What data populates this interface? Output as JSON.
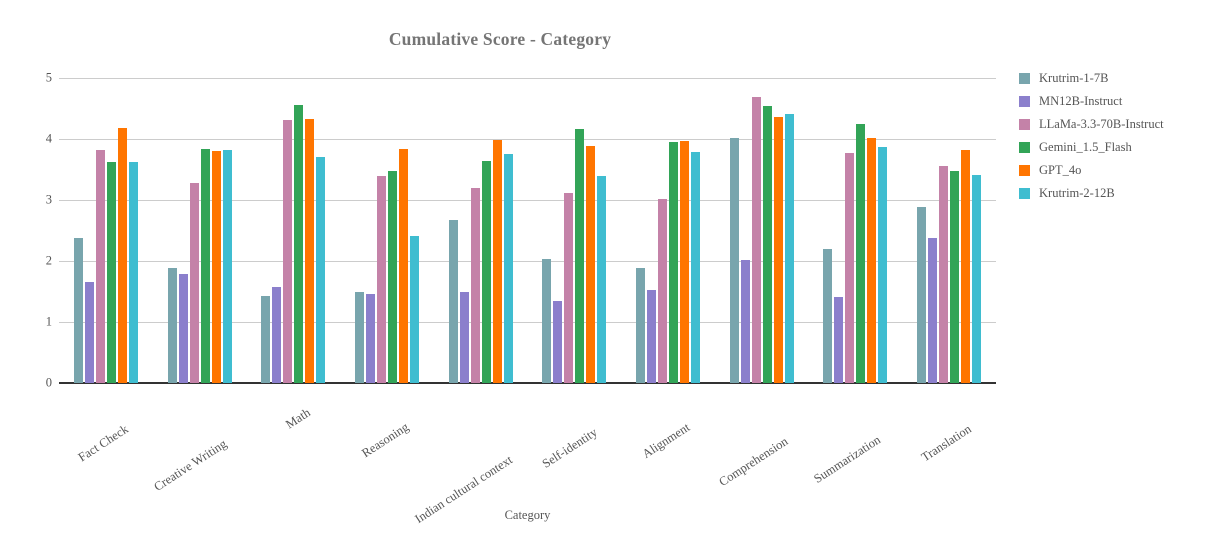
{
  "chart_data": {
    "type": "bar",
    "title": "Cumulative Score - Category",
    "xlabel": "Category",
    "ylabel": "",
    "ylim": [
      0,
      5
    ],
    "yticks": [
      0,
      1,
      2,
      3,
      4,
      5
    ],
    "grid": true,
    "legend_position": "right",
    "categories": [
      "Fact Check",
      "Creative Writing",
      "Math",
      "Reasoning",
      "Indian cultural context",
      "Self-identity",
      "Alignment",
      "Comprehension",
      "Summarization",
      "Translation"
    ],
    "series": [
      {
        "name": "Krutrim-1-7B",
        "color": "#78a5ad",
        "values": [
          2.37,
          1.89,
          1.42,
          1.5,
          2.67,
          2.04,
          1.89,
          4.01,
          2.19,
          2.88
        ]
      },
      {
        "name": "MN12B-Instruct",
        "color": "#8b7fcc",
        "values": [
          1.65,
          1.79,
          1.58,
          1.46,
          1.5,
          1.34,
          1.52,
          2.01,
          1.41,
          2.38
        ]
      },
      {
        "name": "LLaMa-3.3-70B-Instruct",
        "color": "#c482a8",
        "values": [
          3.82,
          3.28,
          4.31,
          3.4,
          3.2,
          3.11,
          3.02,
          4.69,
          3.77,
          3.55
        ]
      },
      {
        "name": "Gemini_1.5_Flash",
        "color": "#32a457",
        "values": [
          3.63,
          3.83,
          4.55,
          3.47,
          3.64,
          4.17,
          3.95,
          4.54,
          4.25,
          3.47
        ]
      },
      {
        "name": "GPT_4o",
        "color": "#ff7500",
        "values": [
          4.18,
          3.8,
          4.33,
          3.83,
          3.98,
          3.88,
          3.96,
          4.36,
          4.01,
          3.82
        ]
      },
      {
        "name": "Krutrim-2-12B",
        "color": "#3fbdd0",
        "values": [
          3.63,
          3.82,
          3.7,
          2.41,
          3.76,
          3.4,
          3.79,
          4.41,
          3.87,
          3.41
        ]
      }
    ]
  },
  "colors": {
    "title": "#757575",
    "tick_text": "#555555",
    "gridline": "#cccccc",
    "axis": "#333333",
    "background": "#ffffff"
  }
}
